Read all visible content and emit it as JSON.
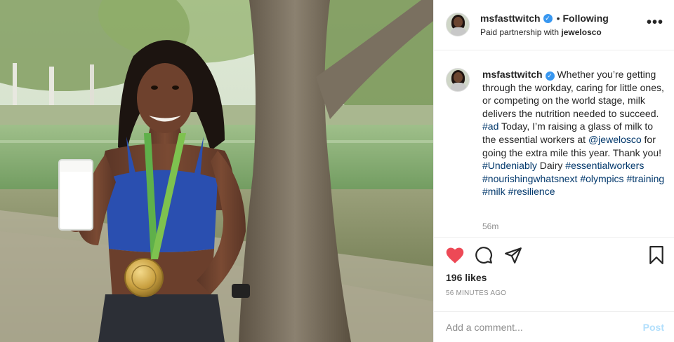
{
  "post": {
    "username": "msfasttwitch",
    "verified_mark": "✓",
    "separator": "•",
    "follow_status": "Following",
    "partnership_prefix": "Paid partnership with ",
    "partner": "jewelosco",
    "more_label": "•••"
  },
  "caption": {
    "username": "msfasttwitch",
    "segments": [
      {
        "text": " Whether you’re getting through the workday, caring for little ones, or competing on the world stage, milk delivers the nutrition needed to succeed. ",
        "link": false
      },
      {
        "text": "#ad",
        "link": true
      },
      {
        "text": " Today, I’m raising a glass of milk to the essential workers at ",
        "link": false
      },
      {
        "text": "@jewelosco",
        "link": true
      },
      {
        "text": " for going the extra mile this year. Thank you! ",
        "link": false
      },
      {
        "text": "#Undeniably",
        "link": true
      },
      {
        "text": " Dairy ",
        "link": false
      },
      {
        "text": "#essentialworkers",
        "link": true
      },
      {
        "text": " ",
        "link": false
      },
      {
        "text": "#nourishingwhatsnext",
        "link": true
      },
      {
        "text": " ",
        "link": false
      },
      {
        "text": "#olympics",
        "link": true
      },
      {
        "text": " ",
        "link": false
      },
      {
        "text": "#training",
        "link": true
      },
      {
        "text": " ",
        "link": false
      },
      {
        "text": "#milk",
        "link": true
      },
      {
        "text": " ",
        "link": false
      },
      {
        "text": "#resilience",
        "link": true
      }
    ],
    "time": "56m"
  },
  "engagement": {
    "likes": "196 likes",
    "posted": "56 MINUTES AGO",
    "liked": true,
    "like_color": "#ed4956",
    "icons": [
      "heart-icon",
      "comment-icon",
      "share-icon",
      "bookmark-icon"
    ]
  },
  "comment_box": {
    "placeholder": "Add a comment...",
    "post_label": "Post"
  }
}
